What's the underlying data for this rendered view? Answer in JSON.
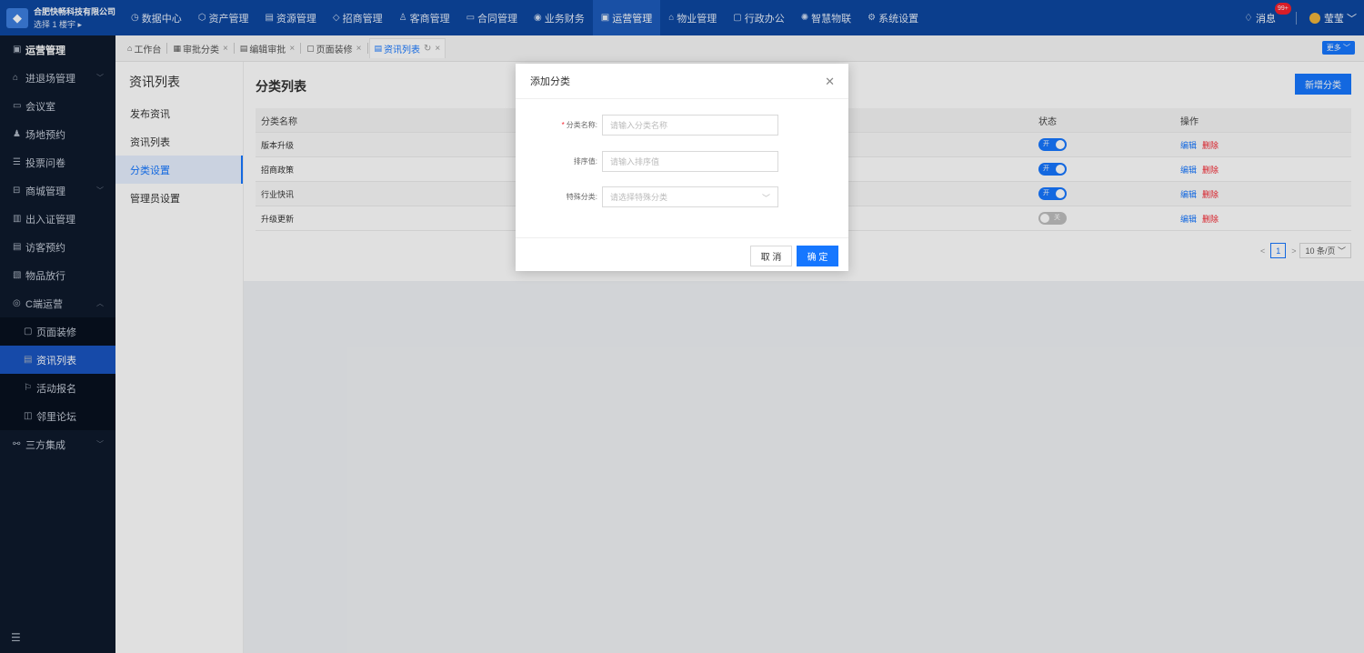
{
  "brand": {
    "company": "合肥快畅科技有限公司",
    "sub": "选择 1 楼宇 ▸"
  },
  "topnav": [
    {
      "label": "数据中心",
      "icon": "◷"
    },
    {
      "label": "资产管理",
      "icon": "⬡"
    },
    {
      "label": "资源管理",
      "icon": "▤"
    },
    {
      "label": "招商管理",
      "icon": "◇"
    },
    {
      "label": "客商管理",
      "icon": "♙"
    },
    {
      "label": "合同管理",
      "icon": "▭"
    },
    {
      "label": "业务财务",
      "icon": "◉"
    },
    {
      "label": "运营管理",
      "icon": "▣",
      "active": true
    },
    {
      "label": "物业管理",
      "icon": "⌂"
    },
    {
      "label": "行政办公",
      "icon": "▢"
    },
    {
      "label": "智慧物联",
      "icon": "✺"
    },
    {
      "label": "系统设置",
      "icon": "⚙"
    }
  ],
  "topright": {
    "messages": "消息",
    "badge": "99+",
    "user": "莹莹"
  },
  "sidebar": {
    "items": [
      {
        "label": "运营管理",
        "icon": "▣",
        "type": "head"
      },
      {
        "label": "进退场管理",
        "icon": "⌂",
        "arrow": "﹀"
      },
      {
        "label": "会议室",
        "icon": "▭"
      },
      {
        "label": "场地预约",
        "icon": "♟"
      },
      {
        "label": "投票问卷",
        "icon": "☰"
      },
      {
        "label": "商城管理",
        "icon": "⊟",
        "arrow": "﹀"
      },
      {
        "label": "出入证管理",
        "icon": "▥"
      },
      {
        "label": "访客预约",
        "icon": "▤"
      },
      {
        "label": "物品放行",
        "icon": "▧"
      },
      {
        "label": "C端运营",
        "icon": "◎",
        "arrow": "︿"
      },
      {
        "label": "页面装修",
        "icon": "▢",
        "type": "sub"
      },
      {
        "label": "资讯列表",
        "icon": "▤",
        "type": "sub",
        "active": true
      },
      {
        "label": "活动报名",
        "icon": "⚐",
        "type": "sub"
      },
      {
        "label": "邻里论坛",
        "icon": "◫",
        "type": "sub"
      },
      {
        "label": "三方集成",
        "icon": "⚯",
        "arrow": "﹀"
      }
    ],
    "collapse_icon": "☰"
  },
  "tabs": [
    {
      "label": "工作台",
      "icon": "⌂",
      "closable": false
    },
    {
      "label": "审批分类",
      "icon": "▦",
      "closable": true
    },
    {
      "label": "编辑审批",
      "icon": "▤",
      "closable": true
    },
    {
      "label": "页面装修",
      "icon": "▢",
      "closable": true
    },
    {
      "label": "资讯列表",
      "icon": "▤",
      "closable": true,
      "active": true,
      "refresh": "↻"
    }
  ],
  "more_label": "更多 ﹀",
  "submenu": {
    "title": "资讯列表",
    "items": [
      {
        "label": "发布资讯"
      },
      {
        "label": "资讯列表"
      },
      {
        "label": "分类设置",
        "active": true
      },
      {
        "label": "管理员设置"
      }
    ]
  },
  "main": {
    "title": "分类列表",
    "add_button": "新增分类",
    "columns": {
      "name": "分类名称",
      "status": "状态",
      "ops": "操作"
    },
    "rows": [
      {
        "name": "版本升级",
        "status_on": true,
        "toggle_label": "开"
      },
      {
        "name": "招商政策",
        "status_on": true,
        "toggle_label": "开"
      },
      {
        "name": "行业快讯",
        "status_on": true,
        "toggle_label": "开"
      },
      {
        "name": "升级更新",
        "status_on": false,
        "toggle_label": "关"
      }
    ],
    "edit_label": "编辑",
    "delete_label": "删除",
    "pagination": {
      "prev": "<",
      "page": "1",
      "next": ">",
      "page_size": "10 条/页 ﹀"
    }
  },
  "modal": {
    "title": "添加分类",
    "close": "✕",
    "fields": [
      {
        "label": "分类名称:",
        "required": true,
        "placeholder": "请输入分类名称",
        "type": "text"
      },
      {
        "label": "排序值:",
        "required": false,
        "placeholder": "请输入排序值",
        "type": "text"
      },
      {
        "label": "特殊分类:",
        "required": false,
        "placeholder": "请选择特殊分类",
        "type": "select"
      }
    ],
    "cancel": "取 消",
    "ok": "确 定"
  },
  "colors": {
    "primary": "#1677ff",
    "header": "#0d47a1",
    "sidebar": "#0e1a2c",
    "danger": "#f5222d"
  }
}
